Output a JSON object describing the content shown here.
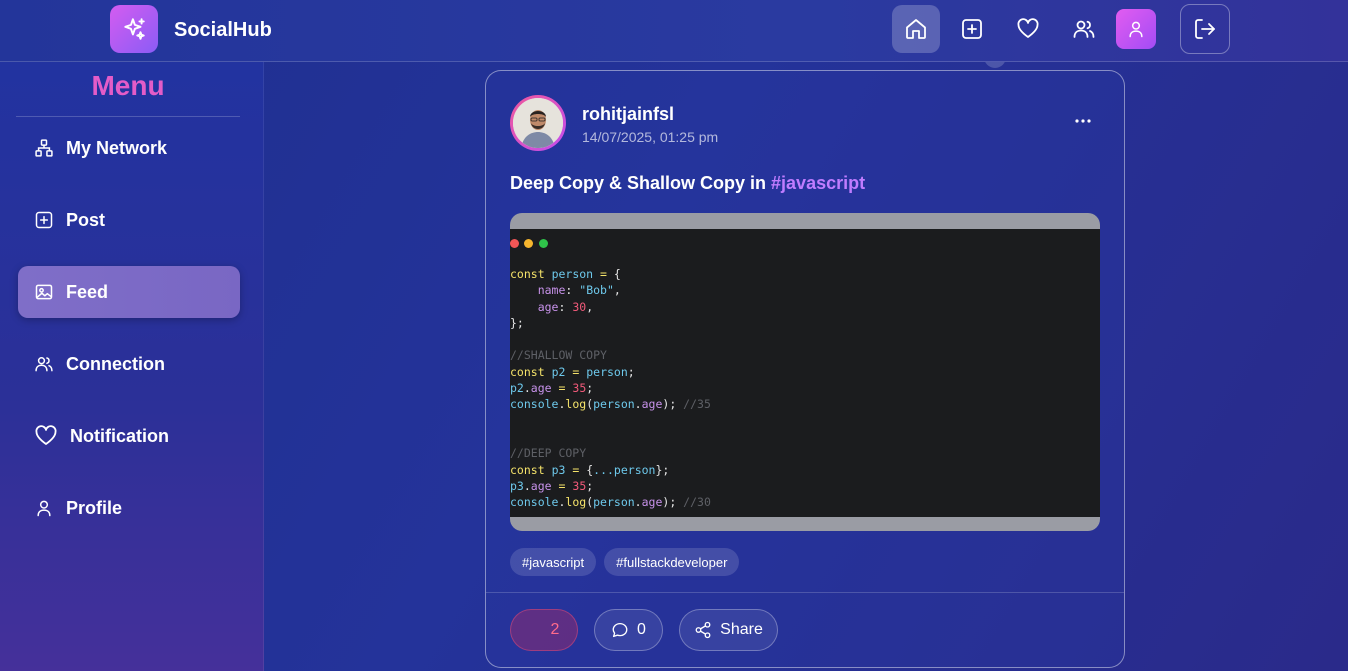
{
  "app": {
    "brand": "SocialHub"
  },
  "sidebar": {
    "title": "Menu",
    "items": [
      {
        "label": "My Network",
        "icon": "network-icon"
      },
      {
        "label": "Post",
        "icon": "plus-square-icon"
      },
      {
        "label": "Feed",
        "icon": "image-icon",
        "active": true
      },
      {
        "label": "Connection",
        "icon": "users-icon"
      },
      {
        "label": "Notification",
        "icon": "heart-icon"
      },
      {
        "label": "Profile",
        "icon": "user-icon"
      }
    ]
  },
  "post": {
    "username": "rohitjainfsl",
    "timestamp": "14/07/2025, 01:25 pm",
    "text": "Deep Copy & Shallow Copy in ",
    "text_hashtag": "#javascript",
    "tags": [
      "#javascript",
      "#fullstackdeveloper"
    ],
    "likes": "2",
    "comments": "0",
    "share_label": "Share"
  },
  "colors": {
    "accent": "#e35cc8",
    "hashtag": "#c07cff",
    "like": "#ff6b8b"
  }
}
